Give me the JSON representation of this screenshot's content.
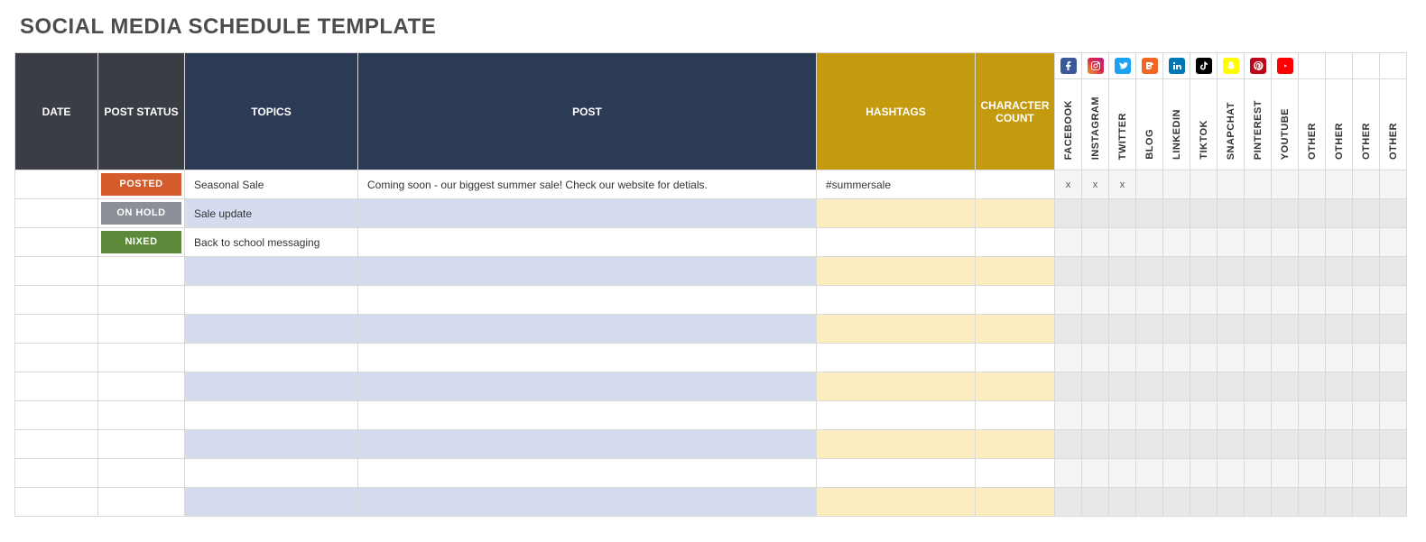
{
  "title": "SOCIAL MEDIA SCHEDULE TEMPLATE",
  "headers": {
    "date": "DATE",
    "status": "POST STATUS",
    "topics": "TOPICS",
    "post": "POST",
    "hashtags": "HASHTAGS",
    "charcount": "CHARACTER COUNT"
  },
  "platforms": [
    {
      "key": "facebook",
      "label": "FACEBOOK",
      "icon": "fb"
    },
    {
      "key": "instagram",
      "label": "INSTAGRAM",
      "icon": "ig"
    },
    {
      "key": "twitter",
      "label": "TWITTER",
      "icon": "tw"
    },
    {
      "key": "blog",
      "label": "BLOG",
      "icon": "bl"
    },
    {
      "key": "linkedin",
      "label": "LINKEDIN",
      "icon": "li"
    },
    {
      "key": "tiktok",
      "label": "TIKTOK",
      "icon": "tk"
    },
    {
      "key": "snapchat",
      "label": "SNAPCHAT",
      "icon": "sc"
    },
    {
      "key": "pinterest",
      "label": "PINTEREST",
      "icon": "pi"
    },
    {
      "key": "youtube",
      "label": "YOUTUBE",
      "icon": "yt"
    },
    {
      "key": "other1",
      "label": "OTHER",
      "icon": ""
    },
    {
      "key": "other2",
      "label": "OTHER",
      "icon": ""
    },
    {
      "key": "other3",
      "label": "OTHER",
      "icon": ""
    },
    {
      "key": "other4",
      "label": "OTHER",
      "icon": ""
    }
  ],
  "status_styles": {
    "POSTED": "posted",
    "ON HOLD": "onhold",
    "NIXED": "nixed"
  },
  "rows": [
    {
      "date": "",
      "status": "POSTED",
      "topic": "Seasonal Sale",
      "post": "Coming soon - our biggest summer sale! Check our website for detials.",
      "hashtags": "#summersale",
      "charcount": "",
      "marks": {
        "facebook": "x",
        "instagram": "x",
        "twitter": "x"
      }
    },
    {
      "date": "",
      "status": "ON HOLD",
      "topic": "Sale update",
      "post": "",
      "hashtags": "",
      "charcount": "",
      "marks": {}
    },
    {
      "date": "",
      "status": "NIXED",
      "topic": "Back to school messaging",
      "post": "",
      "hashtags": "",
      "charcount": "",
      "marks": {}
    },
    {
      "date": "",
      "status": "",
      "topic": "",
      "post": "",
      "hashtags": "",
      "charcount": "",
      "marks": {}
    },
    {
      "date": "",
      "status": "",
      "topic": "",
      "post": "",
      "hashtags": "",
      "charcount": "",
      "marks": {}
    },
    {
      "date": "",
      "status": "",
      "topic": "",
      "post": "",
      "hashtags": "",
      "charcount": "",
      "marks": {}
    },
    {
      "date": "",
      "status": "",
      "topic": "",
      "post": "",
      "hashtags": "",
      "charcount": "",
      "marks": {}
    },
    {
      "date": "",
      "status": "",
      "topic": "",
      "post": "",
      "hashtags": "",
      "charcount": "",
      "marks": {}
    },
    {
      "date": "",
      "status": "",
      "topic": "",
      "post": "",
      "hashtags": "",
      "charcount": "",
      "marks": {}
    },
    {
      "date": "",
      "status": "",
      "topic": "",
      "post": "",
      "hashtags": "",
      "charcount": "",
      "marks": {}
    },
    {
      "date": "",
      "status": "",
      "topic": "",
      "post": "",
      "hashtags": "",
      "charcount": "",
      "marks": {}
    },
    {
      "date": "",
      "status": "",
      "topic": "",
      "post": "",
      "hashtags": "",
      "charcount": "",
      "marks": {}
    }
  ]
}
